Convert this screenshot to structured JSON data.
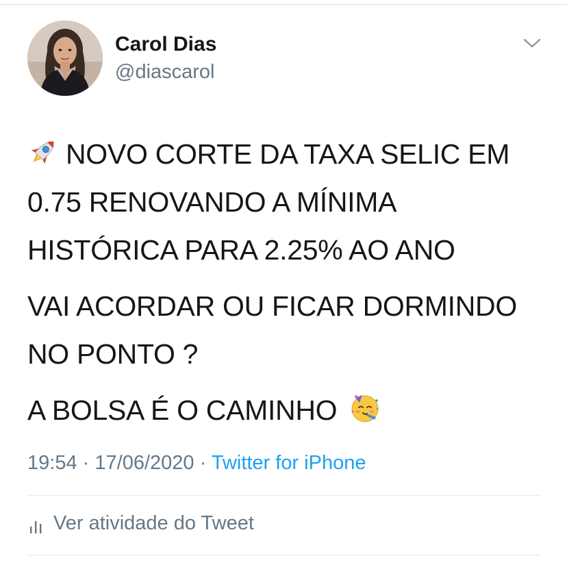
{
  "author": {
    "name": "Carol Dias",
    "handle": "@diascarol"
  },
  "tweet": {
    "paragraphs": [
      {
        "lead_icon": "rocket-icon",
        "lines": [
          "NOVO CORTE DA TAXA SELIC EM",
          "0.75 RENOVANDO A MÍNIMA",
          "HISTÓRICA PARA 2.25% AO ANO"
        ]
      },
      {
        "lines": [
          "VAI ACORDAR OU FICAR DORMINDO",
          "NO PONTO ?"
        ]
      },
      {
        "lines": [
          "A BOLSA É O CAMINHO"
        ],
        "trail_icon": "partying-face-icon"
      }
    ]
  },
  "meta": {
    "time": "19:54",
    "separator": "·",
    "date": "17/06/2020",
    "source": "Twitter for iPhone"
  },
  "activity": {
    "label": "Ver atividade do Tweet",
    "icon": "bar-chart-icon"
  },
  "menu": {
    "icon": "chevron-down-icon"
  },
  "colors": {
    "text": "#14171a",
    "secondary": "#657786",
    "link": "#1da1f2",
    "divider": "#e1e8ed"
  }
}
